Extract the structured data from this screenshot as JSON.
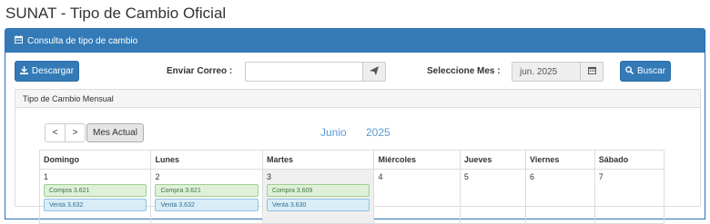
{
  "page": {
    "title": "SUNAT - Tipo de Cambio Oficial"
  },
  "panel": {
    "header": "Consulta de tipo de cambio"
  },
  "toolbar": {
    "download_label": "Descargar",
    "email_label": "Enviar Correo :",
    "email_value": "",
    "month_label": "Seleccione Mes :",
    "month_value": "jun. 2025",
    "search_label": "Buscar"
  },
  "calendar": {
    "panel_title": "Tipo de Cambio Mensual",
    "prev": "<",
    "next": ">",
    "current_month_btn": "Mes Actual",
    "month": "Junio",
    "year": "2025",
    "weekdays": [
      "Domingo",
      "Lunes",
      "Martes",
      "Miércoles",
      "Jueves",
      "Viernes",
      "Sábado"
    ],
    "days": [
      {
        "day": "1",
        "compra": "Compra 3.621",
        "venta": "Venta 3.632"
      },
      {
        "day": "2",
        "compra": "Compra 3.621",
        "venta": "Venta 3.632"
      },
      {
        "day": "3",
        "compra": "Compra 3.609",
        "venta": "Venta 3.630"
      },
      {
        "day": "4"
      },
      {
        "day": "5"
      },
      {
        "day": "6"
      },
      {
        "day": "7"
      }
    ]
  },
  "colors": {
    "primary": "#337ab7",
    "compra_bg": "#dff0d8",
    "venta_bg": "#d9edf7",
    "calendar_title": "#5b9bd5"
  },
  "icons": [
    "calendar-icon",
    "download-icon",
    "send-icon",
    "search-icon"
  ]
}
